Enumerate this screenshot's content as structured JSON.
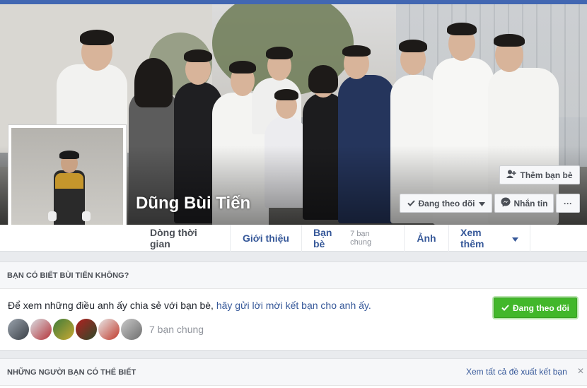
{
  "profile": {
    "name": "Dũng Bùi Tiến"
  },
  "cover_actions": {
    "add_friend": "Thêm bạn bè",
    "following": "Đang theo dõi",
    "message": "Nhắn tin",
    "more": "···"
  },
  "tabs": [
    {
      "label": "Dòng thời gian"
    },
    {
      "label": "Giới thiệu"
    },
    {
      "label": "Bạn bè",
      "sub": "7 bạn chung"
    },
    {
      "label": "Ảnh"
    },
    {
      "label": "Xem thêm"
    }
  ],
  "know_card": {
    "heading": "BẠN CÓ BIẾT BÙI TIẾN KHÔNG?",
    "text_prefix": "Để xem những điều anh ấy chia sẻ với bạn bè,",
    "text_link": "hãy gửi lời mời kết bạn cho anh ấy.",
    "mutual": "7 bạn chung",
    "button": "Đang theo dõi"
  },
  "pymk_card": {
    "heading": "NHỮNG NGƯỜI BẠN CÓ THỂ BIẾT",
    "see_all": "Xem tất cả đề xuất kết bạn",
    "close": "✕"
  },
  "colors": {
    "fb_blue": "#4267b2",
    "link": "#365899",
    "green": "#42b72a"
  },
  "icons": [
    "add-friend-icon",
    "check-icon",
    "caret-down-icon",
    "messenger-icon",
    "more-icon",
    "close-icon"
  ]
}
